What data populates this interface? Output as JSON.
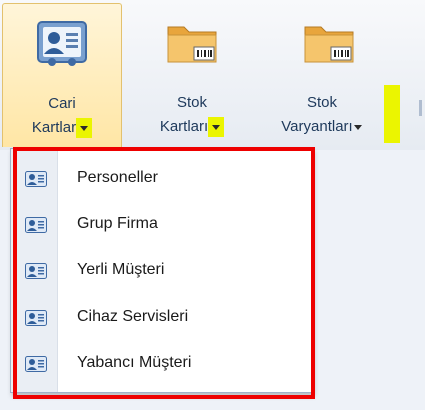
{
  "ribbon": {
    "buttons": [
      {
        "line1": "Cari",
        "line2": "Kartlar",
        "icon": "contact-card-icon",
        "active": true
      },
      {
        "line1": "Stok",
        "line2": "Kartları",
        "icon": "folder-barcode-icon",
        "active": false
      },
      {
        "line1": "Stok",
        "line2": "Varyantları",
        "icon": "folder-barcode-icon",
        "active": false
      }
    ]
  },
  "dropdown": {
    "items": [
      {
        "label": "Personeller",
        "icon": "contact-card-icon"
      },
      {
        "label": "Grup Firma",
        "icon": "contact-card-icon"
      },
      {
        "label": "Yerli Müşteri",
        "icon": "contact-card-icon"
      },
      {
        "label": "Cihaz Servisleri",
        "icon": "contact-card-icon"
      },
      {
        "label": "Yabancı Müşteri",
        "icon": "contact-card-icon"
      }
    ]
  },
  "colors": {
    "highlight_box": "#ee0000",
    "arrow_highlight": "#ebf500",
    "active_button": "#ffe6a5"
  }
}
